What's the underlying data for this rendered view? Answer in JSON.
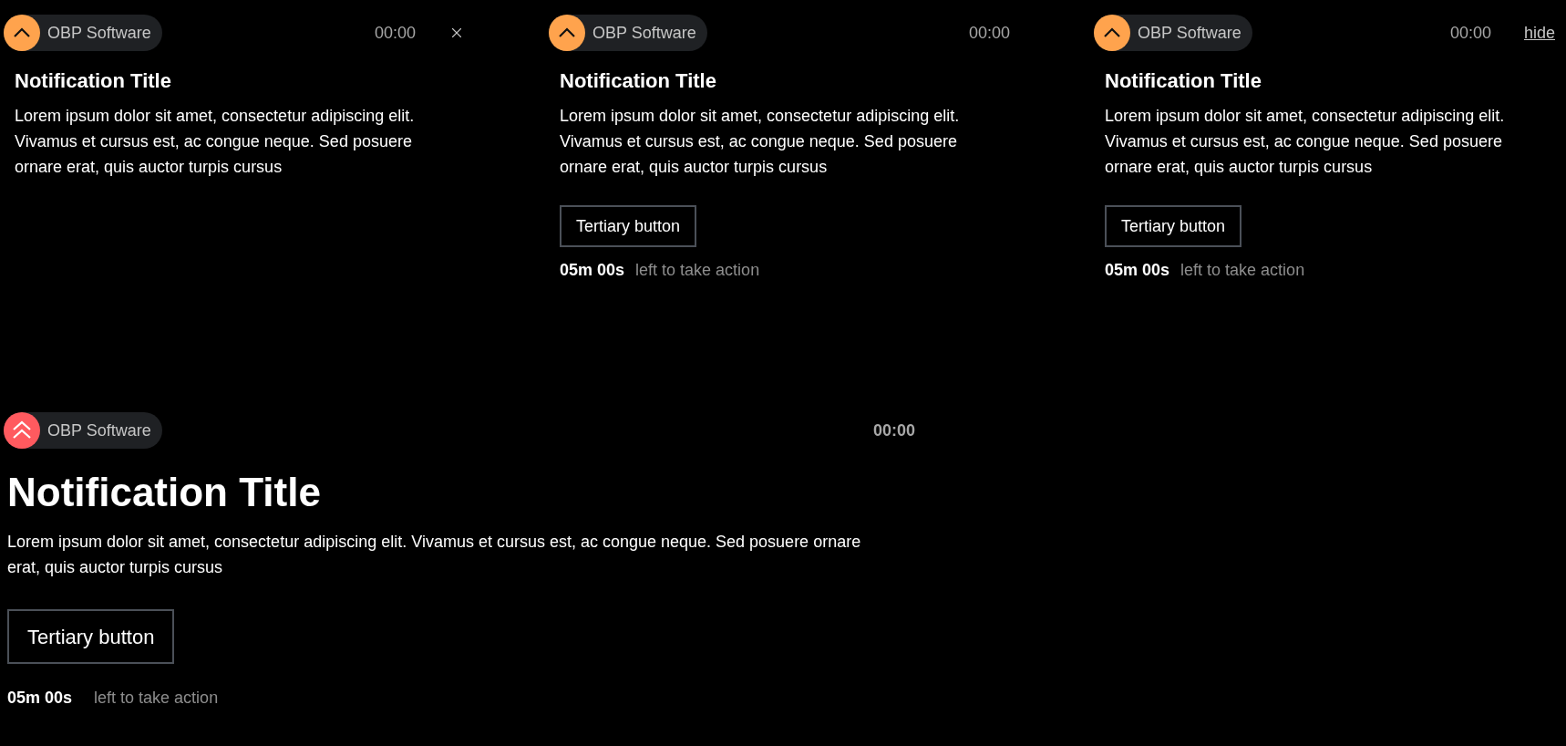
{
  "notifications": [
    {
      "kind": "compact",
      "color": "#ffa34d",
      "source": "OBP Software",
      "time": "00:00",
      "dismiss": {
        "kind": "close"
      },
      "title": "Notification Title",
      "body": "Lorem ipsum dolor sit amet, consectetur adipiscing elit. Vivamus et cursus est, ac congue neque. Sed posuere ornare erat, quis auctor turpis cursus"
    },
    {
      "kind": "compact",
      "color": "#ffa34d",
      "source": "OBP Software",
      "time": "00:00",
      "title": "Notification Title",
      "body": "Lorem ipsum dolor sit amet, consectetur adipiscing elit. Vivamus et cursus est, ac congue neque. Sed posuere ornare erat, quis auctor turpis cursus",
      "button": "Tertiary button",
      "countdown": "05m 00s",
      "countdown_label": "left to take action"
    },
    {
      "kind": "compact",
      "color": "#ffa34d",
      "source": "OBP Software",
      "time": "00:00",
      "dismiss": {
        "kind": "link",
        "label": "hide"
      },
      "title": "Notification Title",
      "body": "Lorem ipsum dolor sit amet, consectetur adipiscing elit. Vivamus et cursus est, ac congue neque. Sed posuere ornare erat, quis auctor turpis cursus",
      "button": "Tertiary button",
      "countdown": "05m 00s",
      "countdown_label": "left to take action"
    },
    {
      "kind": "large",
      "color": "#ff5a5f",
      "source": "OBP Software",
      "time": "00:00",
      "title": "Notification Title",
      "body": "Lorem ipsum dolor sit amet, consectetur adipiscing elit. Vivamus et cursus est, ac congue neque. Sed posuere ornare erat, quis auctor turpis cursus",
      "button": "Tertiary button",
      "countdown": "05m 00s",
      "countdown_label": "left to take action"
    }
  ]
}
